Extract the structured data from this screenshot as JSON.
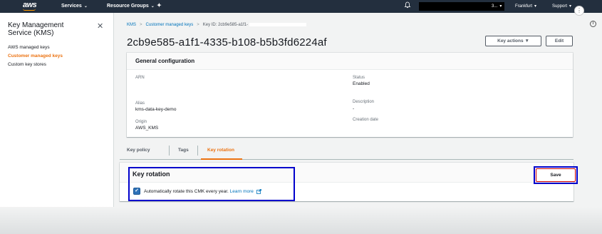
{
  "topnav": {
    "logo": "aws",
    "services": "Services",
    "resource_groups": "Resource Groups",
    "account_suffix": "3...",
    "region": "Frankfurt",
    "support": "Support"
  },
  "sidebar": {
    "title": "Key Management Service (KMS)",
    "close_icon": "close-icon",
    "items": [
      {
        "label": "AWS managed keys",
        "active": false
      },
      {
        "label": "Customer managed keys",
        "active": true
      },
      {
        "label": "Custom key stores",
        "active": false
      }
    ]
  },
  "breadcrumb": {
    "root": "KMS",
    "parent": "Customer managed keys",
    "current": "Key ID: 2cb9e585-a1f1-"
  },
  "page": {
    "title": "2cb9e585-a1f1-4335-b108-b5b3fd6224af",
    "key_actions": "Key actions",
    "edit": "Edit"
  },
  "general_config": {
    "heading": "General configuration",
    "arn_label": "ARN",
    "status_label": "Status",
    "status_value": "Enabled",
    "alias_label": "Alias",
    "alias_value": "kms-data-key-demo",
    "description_label": "Description",
    "description_value": "-",
    "origin_label": "Origin",
    "origin_value": "AWS_KMS",
    "creation_date_label": "Creation date"
  },
  "tabs": [
    {
      "label": "Key policy",
      "active": false
    },
    {
      "label": "Tags",
      "active": false
    },
    {
      "label": "Key rotation",
      "active": true
    }
  ],
  "key_rotation": {
    "heading": "Key rotation",
    "checkbox_checked": true,
    "checkbox_label": "Automatically rotate this CMK every year.",
    "learn_more": "Learn more",
    "save": "Save"
  },
  "colors": {
    "nav_bg": "#232f3e",
    "accent": "#ec7211",
    "link": "#0073bb",
    "highlight_box": "#0000cc",
    "save_highlight": "#cc0000"
  }
}
